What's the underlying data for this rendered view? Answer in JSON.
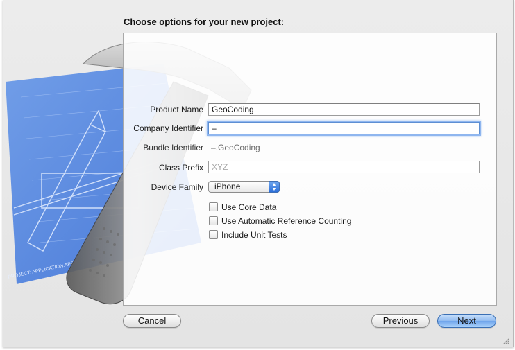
{
  "dialog": {
    "heading": "Choose options for your new project:"
  },
  "form": {
    "product_name": {
      "label": "Product Name",
      "value": "GeoCoding"
    },
    "company_identifier": {
      "label": "Company Identifier",
      "value": "–"
    },
    "bundle_identifier": {
      "label": "Bundle Identifier",
      "value": "–.GeoCoding"
    },
    "class_prefix": {
      "label": "Class Prefix",
      "placeholder": "XYZ"
    },
    "device_family": {
      "label": "Device Family",
      "selected": "iPhone"
    },
    "options": [
      {
        "label": "Use Core Data",
        "checked": false
      },
      {
        "label": "Use Automatic Reference Counting",
        "checked": false
      },
      {
        "label": "Include Unit Tests",
        "checked": false
      }
    ]
  },
  "buttons": {
    "cancel": "Cancel",
    "previous": "Previous",
    "next": "Next"
  },
  "icons": {
    "background_art": "xcode-hammer-blueprint-icon",
    "popup_arrows": "up-down-arrows-icon",
    "resize": "resize-grip-icon"
  },
  "colors": {
    "focus_ring": "#8fb6ef",
    "primary_button": "#6fa4eb",
    "blueprint": "#4d7fe0"
  }
}
